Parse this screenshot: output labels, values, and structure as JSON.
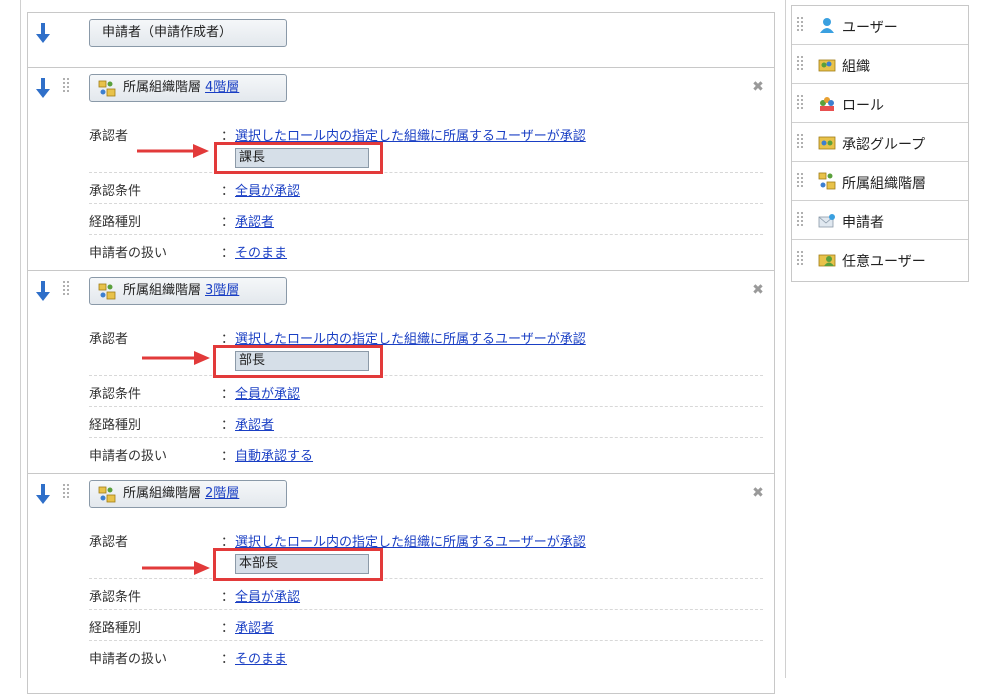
{
  "flow": {
    "start_node": {
      "label": "申請者（申請作成者）"
    },
    "nodes": [
      {
        "label": "所属組織階層",
        "level_link": "4階層",
        "approver_label": "承認者",
        "approver_value": "選択したロール内の指定した組織に所属するユーザーが承認",
        "role_value": "課長",
        "condition_label": "承認条件",
        "condition_value": "全員が承認",
        "route_label": "経路種別",
        "route_value": "承認者",
        "applicant_label": "申請者の扱い",
        "applicant_value": "そのまま"
      },
      {
        "label": "所属組織階層",
        "level_link": "3階層",
        "approver_label": "承認者",
        "approver_value": "選択したロール内の指定した組織に所属するユーザーが承認",
        "role_value": "部長",
        "condition_label": "承認条件",
        "condition_value": "全員が承認",
        "route_label": "経路種別",
        "route_value": "承認者",
        "applicant_label": "申請者の扱い",
        "applicant_value": "自動承認する"
      },
      {
        "label": "所属組織階層",
        "level_link": "2階層",
        "approver_label": "承認者",
        "approver_value": "選択したロール内の指定した組織に所属するユーザーが承認",
        "role_value": "本部長",
        "condition_label": "承認条件",
        "condition_value": "全員が承認",
        "route_label": "経路種別",
        "route_value": "承認者",
        "applicant_label": "申請者の扱い",
        "applicant_value": "そのまま"
      }
    ],
    "colon": "："
  },
  "palette": {
    "items": [
      {
        "label": "ユーザー",
        "icon": "user-icon"
      },
      {
        "label": "組織",
        "icon": "organization-icon"
      },
      {
        "label": "ロール",
        "icon": "role-icon"
      },
      {
        "label": "承認グループ",
        "icon": "approval-group-icon"
      },
      {
        "label": "所属組織階層",
        "icon": "org-hierarchy-icon"
      },
      {
        "label": "申請者",
        "icon": "applicant-icon"
      },
      {
        "label": "任意ユーザー",
        "icon": "any-user-icon"
      }
    ]
  },
  "colors": {
    "link": "#1a3fc4",
    "highlight": "#e23a3a",
    "arrow_blue": "#2f6fc9"
  }
}
